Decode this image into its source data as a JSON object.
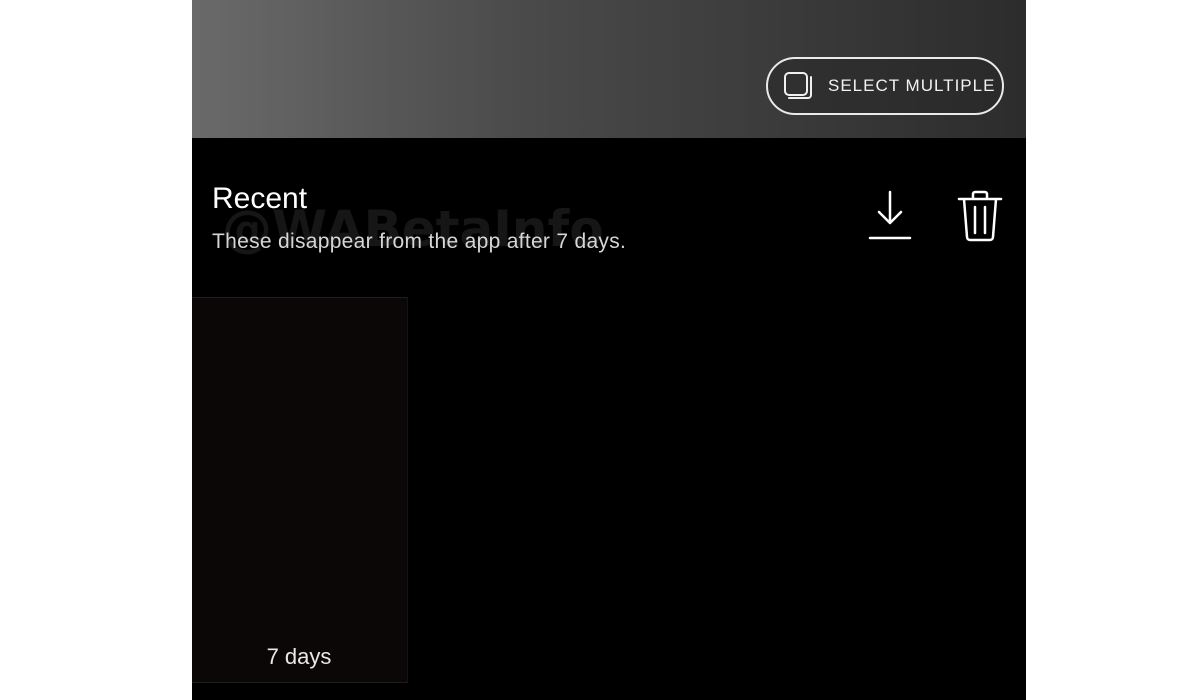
{
  "header": {
    "select_multiple_label": "SELECT MULTIPLE",
    "select_multiple_icon": "stacked-squares-icon"
  },
  "section": {
    "title": "Recent",
    "subtitle": "These disappear from the app after 7 days.",
    "watermark": "@WABetaInfo"
  },
  "actions": {
    "download_icon": "download-icon",
    "delete_icon": "trash-icon"
  },
  "items": [
    {
      "expiry_label": "7 days"
    }
  ],
  "colors": {
    "background": "#000000",
    "top_bar_start": "#6a6a6a",
    "top_bar_end": "#2c2c2c",
    "text_primary": "#ffffff",
    "text_secondary": "#d6d6d6"
  }
}
